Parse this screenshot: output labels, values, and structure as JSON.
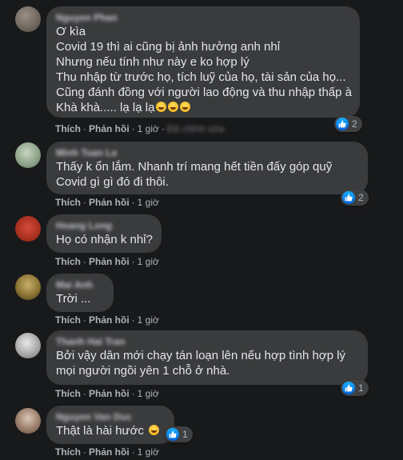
{
  "action_like": "Thích",
  "action_reply": "Phản hồi",
  "comments": [
    {
      "author": "Nguyen Phan",
      "lines": [
        "Ơ kìa",
        "Covid 19 thì ai cũng bị ảnh hưởng anh nhỉ",
        "Nhưng nếu tính như này e ko hợp lý",
        "Thu nhập từ trước họ, tích luỹ của họ, tài sản của họ...",
        "Cũng đánh đồng với người lao động và thu nhập thấp à"
      ],
      "last_line": "Khà khà..... lạ lạ lạ",
      "time": "1 giờ",
      "extra_time": "Đã chỉnh sửa",
      "reaction_count": "2"
    },
    {
      "author": "Minh Tuan Le",
      "lines": [
        "Thấy k ổn lắm. Nhanh trí mang hết tiền đấy góp quỹ",
        "Covid gì gì đó đi thôi."
      ],
      "time": "1 giờ",
      "reaction_count": "2"
    },
    {
      "author": "Hoang Long",
      "lines": [
        "Họ có nhận k nhỉ?"
      ],
      "time": "1 giờ"
    },
    {
      "author": "Mai Anh",
      "lines": [
        "Trời ..."
      ],
      "time": "1 giờ"
    },
    {
      "author": "Thanh Hai Tran",
      "lines": [
        "Bởi vậy dân mới chạy tán loạn lên nếu hợp tình hợp lý",
        "mọi người ngồi yên 1 chỗ ở nhà."
      ],
      "time": "1 giờ",
      "reaction_count": "1"
    },
    {
      "author": "Nguyen Van Duc",
      "lines": [
        "Thật là hài hước"
      ],
      "time": "1 giờ",
      "reaction_count": "1"
    }
  ],
  "colors": {
    "background": "#18191a",
    "bubble": "#3a3b3c",
    "text": "#e4e6eb",
    "secondary_text": "#b0b3b8",
    "like_blue": "#1877f2"
  },
  "icons": {
    "reaction": "like-icon",
    "laugh": "laughing-emoji-icon",
    "grin": "grinning-emoji-icon"
  }
}
